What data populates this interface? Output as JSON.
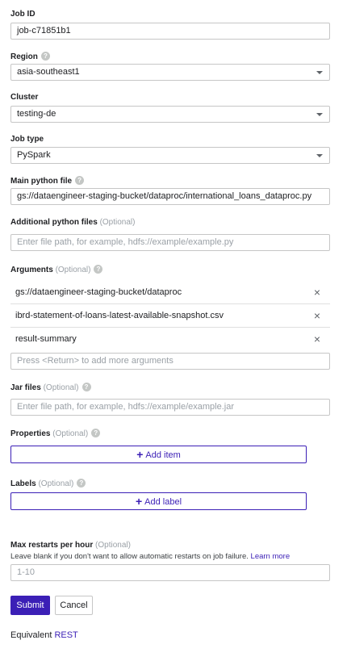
{
  "job_id": {
    "label": "Job ID",
    "value": "job-c71851b1"
  },
  "region": {
    "label": "Region",
    "help_icon": "help-icon",
    "value": "asia-southeast1"
  },
  "cluster": {
    "label": "Cluster",
    "value": "testing-de"
  },
  "job_type": {
    "label": "Job type",
    "value": "PySpark"
  },
  "main_python_file": {
    "label": "Main python file",
    "help_icon": "help-icon",
    "value": "gs://dataengineer-staging-bucket/dataproc/international_loans_dataproc.py"
  },
  "additional_python_files": {
    "label": "Additional python files",
    "optional": "(Optional)",
    "placeholder": "Enter file path, for example, hdfs://example/example.py"
  },
  "arguments": {
    "label": "Arguments",
    "optional": "(Optional)",
    "help_icon": "help-icon",
    "items": [
      "gs://dataengineer-staging-bucket/dataproc",
      "ibrd-statement-of-loans-latest-available-snapshot.csv",
      "result-summary"
    ],
    "remove_glyph": "×",
    "placeholder": "Press <Return> to add more arguments"
  },
  "jar_files": {
    "label": "Jar files",
    "optional": "(Optional)",
    "help_icon": "help-icon",
    "placeholder": "Enter file path, for example, hdfs://example/example.jar"
  },
  "properties": {
    "label": "Properties",
    "optional": "(Optional)",
    "help_icon": "help-icon",
    "add_label": "Add item"
  },
  "labels": {
    "label": "Labels",
    "optional": "(Optional)",
    "help_icon": "help-icon",
    "add_label": "Add label"
  },
  "max_restarts": {
    "label": "Max restarts per hour",
    "optional": "(Optional)",
    "hint": "Leave blank if you don't want to allow automatic restarts on job failure.",
    "hint_link": "Learn more",
    "placeholder": "1-10"
  },
  "actions": {
    "submit": "Submit",
    "cancel": "Cancel"
  },
  "footer": {
    "equivalent": "Equivalent",
    "rest_link": "REST"
  },
  "colors": {
    "accent": "#3b1fb6",
    "border": "#c6c6c6",
    "muted": "#9aa0a6"
  }
}
